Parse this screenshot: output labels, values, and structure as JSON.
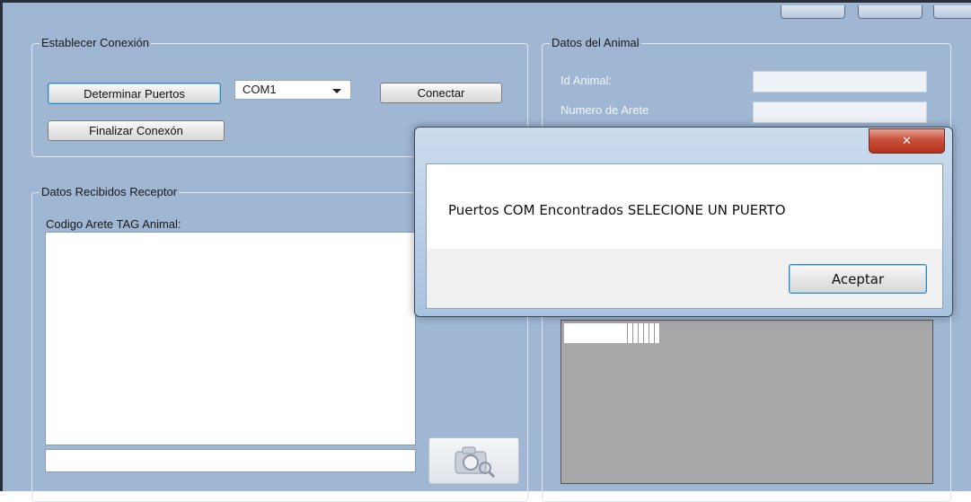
{
  "connection_group": {
    "title": "Establecer Conexión",
    "detect_ports_label": "Determinar Puertos",
    "port_select_value": "COM1",
    "connect_label": "Conectar",
    "end_connection_label": "Finalizar Conexón"
  },
  "receiver_group": {
    "title": "Datos Recibidos Receptor",
    "tag_label": "Codigo Arete TAG Animal:",
    "camera_icon": "camera-icon"
  },
  "animal_group": {
    "title": "Datos del Animal",
    "id_label": "Id Animal:",
    "tag_number_label": "Numero de Arete"
  },
  "dialog": {
    "message": "Puertos COM Encontrados SELECIONE UN PUERTO",
    "ok_label": "Aceptar",
    "close_glyph": "✕"
  }
}
